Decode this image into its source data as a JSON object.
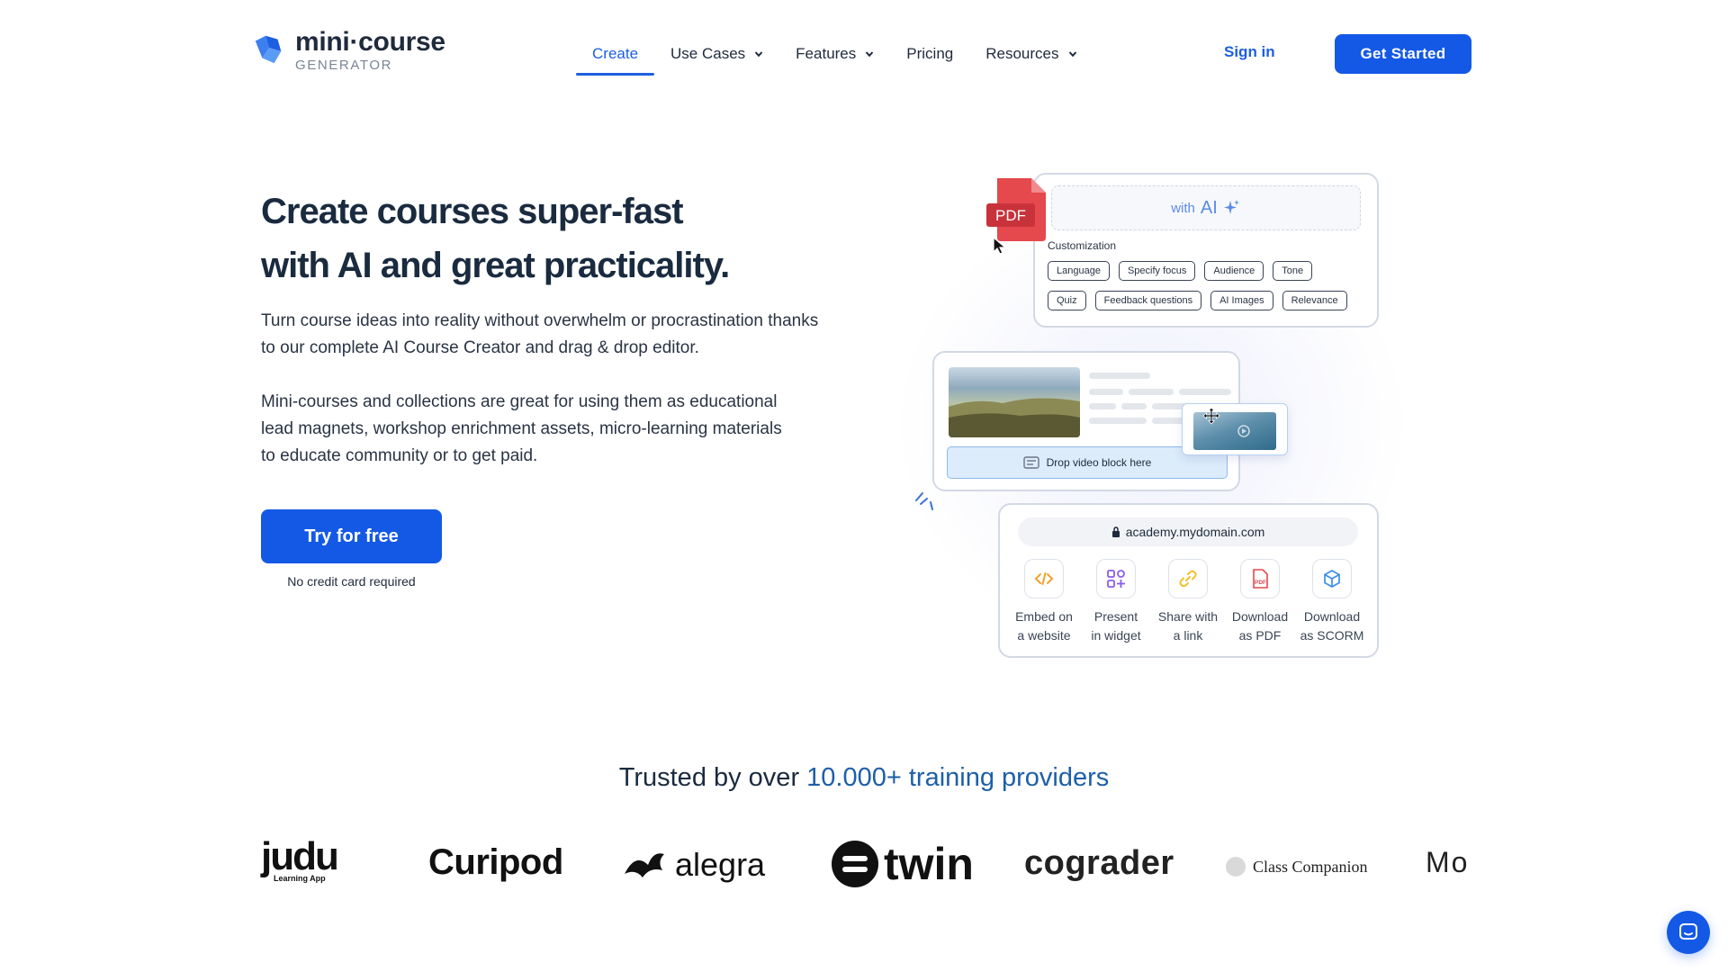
{
  "header": {
    "logo_name": "mini·course",
    "logo_sub": "GENERATOR",
    "nav": [
      {
        "label": "Create",
        "active": true,
        "dropdown": false
      },
      {
        "label": "Use Cases",
        "dropdown": true
      },
      {
        "label": "Features",
        "dropdown": true
      },
      {
        "label": "Pricing",
        "dropdown": false
      },
      {
        "label": "Resources",
        "dropdown": true
      }
    ],
    "signin": "Sign in",
    "get_started": "Get Started"
  },
  "hero": {
    "title_line1": "Create courses super-fast",
    "title_line2": "with AI and great practicality.",
    "para1": "Turn course ideas into reality without overwhelm or procrastination thanks to our complete AI Course Creator and drag & drop editor.",
    "para2": "Mini-courses and collections are great for using them as educational lead magnets, workshop enrichment assets, micro-learning materials to educate community or to get paid.",
    "cta": "Try for free",
    "cta_note": "No credit card required"
  },
  "illustration": {
    "pdf_label": "PDF",
    "ai_with": "with",
    "ai_label": "AI",
    "customization_label": "Customization",
    "chips_row1": [
      "Language",
      "Specify focus",
      "Audience",
      "Tone"
    ],
    "chips_row2": [
      "Quiz",
      "Feedback questions",
      "AI Images",
      "Relevance"
    ],
    "drop_label": "Drop video block here",
    "url": "academy.mydomain.com",
    "exports": [
      {
        "label": "Embed on\na website",
        "icon": "code-icon",
        "color": "#f2a12b"
      },
      {
        "label": "Present\nin widget",
        "icon": "widget-icon",
        "color": "#8a5cf0"
      },
      {
        "label": "Share with\na link",
        "icon": "link-icon",
        "color": "#f2c12b"
      },
      {
        "label": "Download\nas PDF",
        "icon": "pdf-file-icon",
        "color": "#e5484d"
      },
      {
        "label": "Download\nas SCORM",
        "icon": "cube-icon",
        "color": "#3b8fe8"
      }
    ]
  },
  "trusted": {
    "prefix": "Trusted by over ",
    "highlight": "10.000+ training providers"
  },
  "logos": {
    "judu": "judu",
    "judu_sub": "Learning App",
    "curipod": "Curipod",
    "alegra": "alegra",
    "twin": "twin",
    "cograder": "cograder",
    "class_companion": "Class Companion",
    "mo": "Mo"
  },
  "colors": {
    "brand_blue": "#1459e6",
    "heading": "#1a2b3f"
  }
}
